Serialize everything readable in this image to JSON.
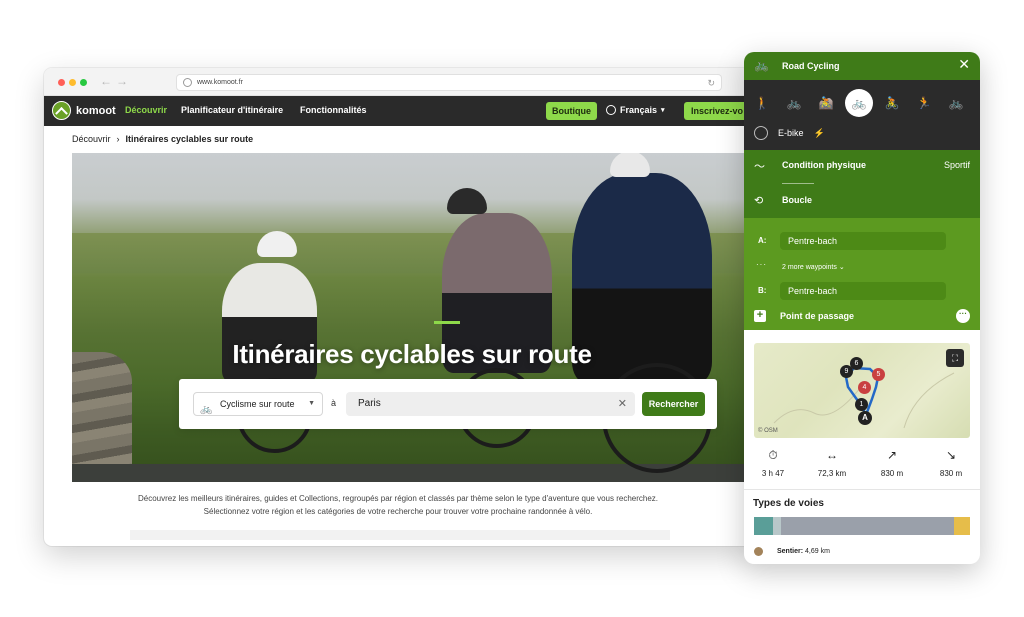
{
  "browser": {
    "url": "www.komoot.fr"
  },
  "topnav": {
    "logo": "komoot",
    "links": [
      "Découvrir",
      "Planificateur d'itinéraire",
      "Fonctionnalités"
    ],
    "shop": "Boutique",
    "language": "Français",
    "signup": "Inscrivez-vo"
  },
  "breadcrumb": {
    "root": "Découvrir",
    "current": "Itinéraires cyclables sur route"
  },
  "hero": {
    "title": "Itinéraires cyclables sur route"
  },
  "search": {
    "sport": "Cyclisme sur route",
    "prep": "à",
    "location": "Paris",
    "button": "Rechercher"
  },
  "description": {
    "line1": "Découvrez les meilleurs itinéraires, guides et Collections, regroupés par région et classés par thème selon le type d'aventure que vous recherchez.",
    "line2": "Sélectionnez votre région et les catégories de votre recherche pour trouver votre prochaine randonnée à vélo."
  },
  "planner": {
    "title": "Road Cycling",
    "ebike": "E-bike",
    "fitness_label": "Condition physique",
    "fitness_value": "Sportif",
    "loop_label": "Boucle",
    "waypoint_a_label": "A:",
    "waypoint_a": "Pentre-bach",
    "more_waypoints": "2 more waypoints",
    "waypoint_b_label": "B:",
    "waypoint_b": "Pentre-bach",
    "add_waypoint": "Point de passage",
    "map_attribution": "© OSM",
    "stats": {
      "duration": "3 h 47",
      "distance": "72,3 km",
      "ascent": "830 m",
      "descent": "830 m"
    },
    "types_title": "Types de voies",
    "type_colors": [
      "#5a9e98",
      "#b8c7c9",
      "#9aa0aa",
      "#e6bd4a"
    ],
    "legend_label": "Sentier:",
    "legend_value": "4,69 km",
    "map_markers": [
      "9",
      "6",
      "5",
      "4",
      "1",
      "A"
    ]
  }
}
